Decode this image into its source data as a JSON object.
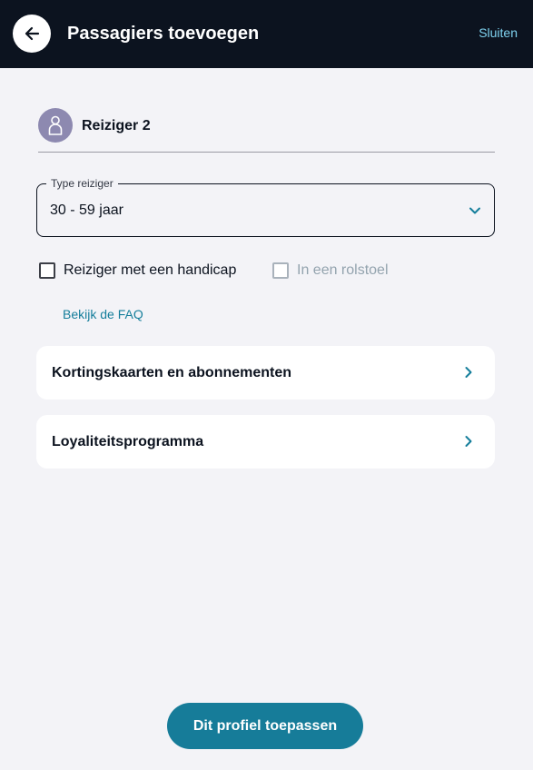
{
  "header": {
    "title": "Passagiers toevoegen",
    "close_label": "Sluiten",
    "back_icon": "arrow-left-icon"
  },
  "traveler": {
    "name": "Reiziger 2",
    "avatar_icon": "person-icon",
    "avatar_color": "#8d89b0"
  },
  "type_select": {
    "legend": "Type reiziger",
    "value": "30 - 59 jaar",
    "icon": "chevron-down-icon"
  },
  "options": {
    "handicap": {
      "label": "Reiziger met een handicap",
      "checked": false
    },
    "wheelchair": {
      "label": "In een rolstoel",
      "checked": false,
      "disabled": true
    }
  },
  "faq_link": "Bekijk de FAQ",
  "cards": [
    {
      "label": "Kortingskaarten en abonnementen",
      "icon": "chevron-right-icon"
    },
    {
      "label": "Loyaliteitsprogramma",
      "icon": "chevron-right-icon"
    }
  ],
  "apply_button": "Dit profiel toepassen",
  "colors": {
    "header_bg": "#0c131f",
    "accent": "#167c99",
    "link": "#7fd3f0",
    "page_bg": "#f3f3f7"
  }
}
